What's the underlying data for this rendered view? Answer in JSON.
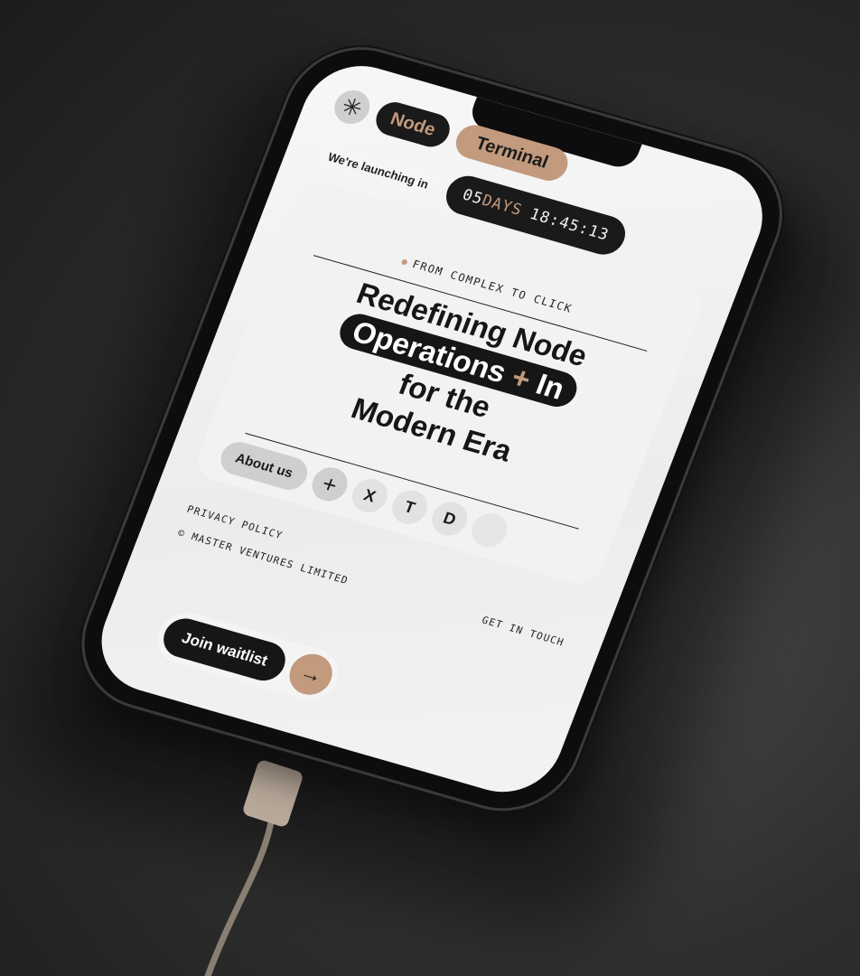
{
  "colors": {
    "accent": "#c39a7d",
    "dark": "#161616",
    "surface": "#f2f2f2"
  },
  "topbar": {
    "logo_icon": "asterisk-icon",
    "node_label": "Node",
    "terminal_label": "Terminal"
  },
  "launch": {
    "label": "We're launching in",
    "days_value": "05",
    "days_unit": "DAYS",
    "time": "18:45:13"
  },
  "hero": {
    "eyebrow": "FROM COMPLEX TO CLICK",
    "line1": "Redefining Node",
    "pill_text_1": "Operations",
    "pill_plus": "+",
    "pill_text_2": "In",
    "line3": "for the",
    "line4": "Modern Era"
  },
  "actions": {
    "about_label": "About us",
    "plus_icon": "plus-icon",
    "social": [
      "X",
      "T",
      "D"
    ]
  },
  "footer": {
    "privacy": "PRIVACY POLICY",
    "copyright": "© MASTER VENTURES LIMITED",
    "contact": "GET IN TOUCH"
  },
  "cta": {
    "waitlist_label": "Join waitlist",
    "arrow_icon": "arrow-right-icon"
  }
}
